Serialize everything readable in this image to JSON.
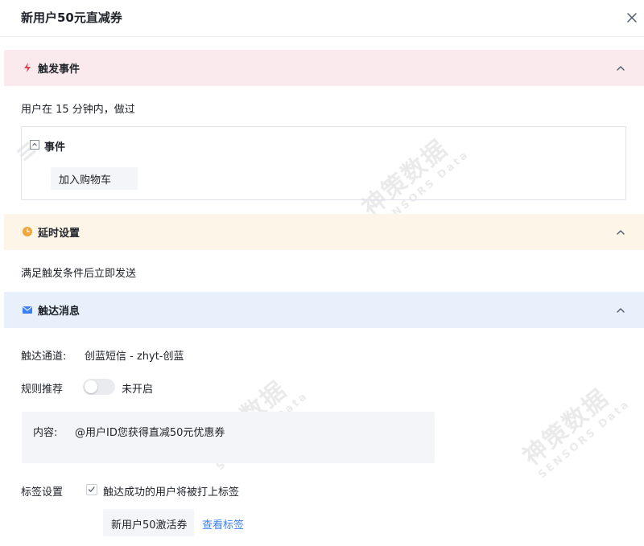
{
  "dialog": {
    "title": "新用户50元直减券"
  },
  "trigger": {
    "title": "触发事件",
    "description": "用户在 15 分钟内，做过",
    "event_group_label": "事件",
    "event_name": "加入购物车"
  },
  "delay": {
    "title": "延时设置",
    "description": "满足触发条件后立即发送"
  },
  "reach": {
    "title": "触达消息",
    "channel_label": "触达通道:",
    "channel_value": "创蓝短信 - zhyt-创蓝",
    "rule_label": "规则推荐",
    "rule_toggle_text": "未开启",
    "rule_enabled": false,
    "content_label": "内容:",
    "content_value": "@用户ID您获得直减50元优惠券",
    "tag_label": "标签设置",
    "tag_checkbox_text": "触达成功的用户将被打上标签",
    "tag_checked": true,
    "tag_name": "新用户50激活券",
    "view_tags_link": "查看标签"
  },
  "watermark": {
    "text": "神策数据",
    "subtext": "SENSORS Data"
  },
  "colors": {
    "trigger_bar": "#fbeaed",
    "delay_bar": "#fdf5e8",
    "reach_bar": "#e8f1fb",
    "trigger_icon": "#e0424f",
    "delay_icon": "#f2a53a",
    "reach_icon": "#3d7ff5",
    "link": "#3d7ff5"
  },
  "icons": {
    "close": "close-icon",
    "trigger": "lightning-icon",
    "delay": "clock-icon",
    "reach": "envelope-icon",
    "collapse": "chevron-up-icon"
  }
}
